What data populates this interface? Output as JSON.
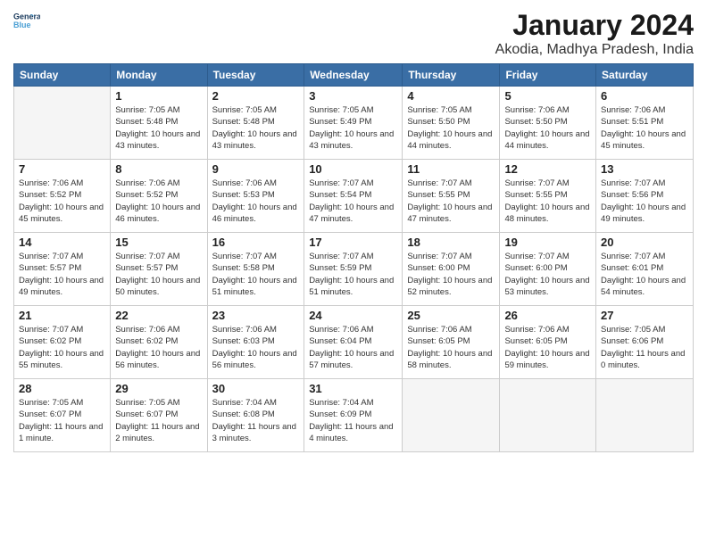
{
  "header": {
    "logo_line1": "General",
    "logo_line2": "Blue",
    "month": "January 2024",
    "location": "Akodia, Madhya Pradesh, India"
  },
  "weekdays": [
    "Sunday",
    "Monday",
    "Tuesday",
    "Wednesday",
    "Thursday",
    "Friday",
    "Saturday"
  ],
  "weeks": [
    [
      {
        "day": "",
        "info": ""
      },
      {
        "day": "1",
        "info": "Sunrise: 7:05 AM\nSunset: 5:48 PM\nDaylight: 10 hours\nand 43 minutes."
      },
      {
        "day": "2",
        "info": "Sunrise: 7:05 AM\nSunset: 5:48 PM\nDaylight: 10 hours\nand 43 minutes."
      },
      {
        "day": "3",
        "info": "Sunrise: 7:05 AM\nSunset: 5:49 PM\nDaylight: 10 hours\nand 43 minutes."
      },
      {
        "day": "4",
        "info": "Sunrise: 7:05 AM\nSunset: 5:50 PM\nDaylight: 10 hours\nand 44 minutes."
      },
      {
        "day": "5",
        "info": "Sunrise: 7:06 AM\nSunset: 5:50 PM\nDaylight: 10 hours\nand 44 minutes."
      },
      {
        "day": "6",
        "info": "Sunrise: 7:06 AM\nSunset: 5:51 PM\nDaylight: 10 hours\nand 45 minutes."
      }
    ],
    [
      {
        "day": "7",
        "info": "Sunrise: 7:06 AM\nSunset: 5:52 PM\nDaylight: 10 hours\nand 45 minutes."
      },
      {
        "day": "8",
        "info": "Sunrise: 7:06 AM\nSunset: 5:52 PM\nDaylight: 10 hours\nand 46 minutes."
      },
      {
        "day": "9",
        "info": "Sunrise: 7:06 AM\nSunset: 5:53 PM\nDaylight: 10 hours\nand 46 minutes."
      },
      {
        "day": "10",
        "info": "Sunrise: 7:07 AM\nSunset: 5:54 PM\nDaylight: 10 hours\nand 47 minutes."
      },
      {
        "day": "11",
        "info": "Sunrise: 7:07 AM\nSunset: 5:55 PM\nDaylight: 10 hours\nand 47 minutes."
      },
      {
        "day": "12",
        "info": "Sunrise: 7:07 AM\nSunset: 5:55 PM\nDaylight: 10 hours\nand 48 minutes."
      },
      {
        "day": "13",
        "info": "Sunrise: 7:07 AM\nSunset: 5:56 PM\nDaylight: 10 hours\nand 49 minutes."
      }
    ],
    [
      {
        "day": "14",
        "info": "Sunrise: 7:07 AM\nSunset: 5:57 PM\nDaylight: 10 hours\nand 49 minutes."
      },
      {
        "day": "15",
        "info": "Sunrise: 7:07 AM\nSunset: 5:57 PM\nDaylight: 10 hours\nand 50 minutes."
      },
      {
        "day": "16",
        "info": "Sunrise: 7:07 AM\nSunset: 5:58 PM\nDaylight: 10 hours\nand 51 minutes."
      },
      {
        "day": "17",
        "info": "Sunrise: 7:07 AM\nSunset: 5:59 PM\nDaylight: 10 hours\nand 51 minutes."
      },
      {
        "day": "18",
        "info": "Sunrise: 7:07 AM\nSunset: 6:00 PM\nDaylight: 10 hours\nand 52 minutes."
      },
      {
        "day": "19",
        "info": "Sunrise: 7:07 AM\nSunset: 6:00 PM\nDaylight: 10 hours\nand 53 minutes."
      },
      {
        "day": "20",
        "info": "Sunrise: 7:07 AM\nSunset: 6:01 PM\nDaylight: 10 hours\nand 54 minutes."
      }
    ],
    [
      {
        "day": "21",
        "info": "Sunrise: 7:07 AM\nSunset: 6:02 PM\nDaylight: 10 hours\nand 55 minutes."
      },
      {
        "day": "22",
        "info": "Sunrise: 7:06 AM\nSunset: 6:02 PM\nDaylight: 10 hours\nand 56 minutes."
      },
      {
        "day": "23",
        "info": "Sunrise: 7:06 AM\nSunset: 6:03 PM\nDaylight: 10 hours\nand 56 minutes."
      },
      {
        "day": "24",
        "info": "Sunrise: 7:06 AM\nSunset: 6:04 PM\nDaylight: 10 hours\nand 57 minutes."
      },
      {
        "day": "25",
        "info": "Sunrise: 7:06 AM\nSunset: 6:05 PM\nDaylight: 10 hours\nand 58 minutes."
      },
      {
        "day": "26",
        "info": "Sunrise: 7:06 AM\nSunset: 6:05 PM\nDaylight: 10 hours\nand 59 minutes."
      },
      {
        "day": "27",
        "info": "Sunrise: 7:05 AM\nSunset: 6:06 PM\nDaylight: 11 hours\nand 0 minutes."
      }
    ],
    [
      {
        "day": "28",
        "info": "Sunrise: 7:05 AM\nSunset: 6:07 PM\nDaylight: 11 hours\nand 1 minute."
      },
      {
        "day": "29",
        "info": "Sunrise: 7:05 AM\nSunset: 6:07 PM\nDaylight: 11 hours\nand 2 minutes."
      },
      {
        "day": "30",
        "info": "Sunrise: 7:04 AM\nSunset: 6:08 PM\nDaylight: 11 hours\nand 3 minutes."
      },
      {
        "day": "31",
        "info": "Sunrise: 7:04 AM\nSunset: 6:09 PM\nDaylight: 11 hours\nand 4 minutes."
      },
      {
        "day": "",
        "info": ""
      },
      {
        "day": "",
        "info": ""
      },
      {
        "day": "",
        "info": ""
      }
    ]
  ]
}
